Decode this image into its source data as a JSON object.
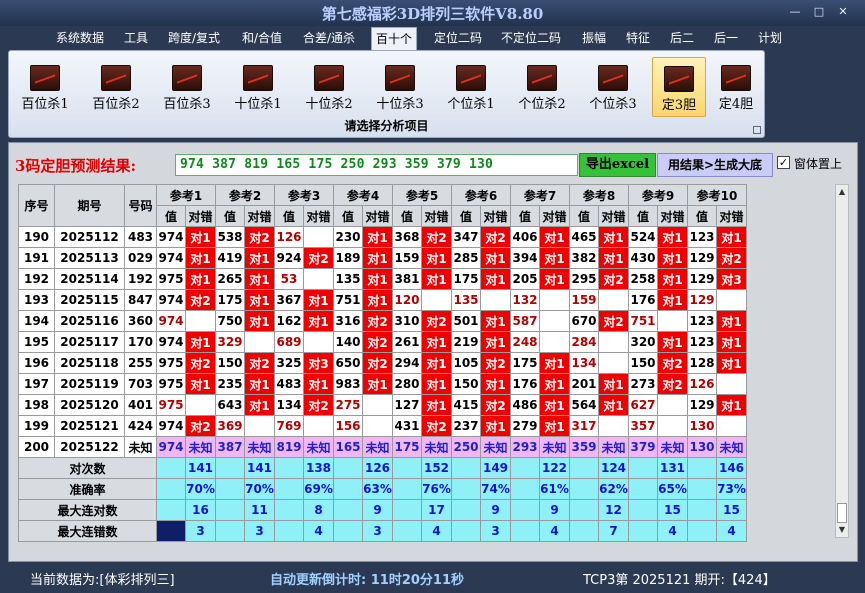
{
  "app": {
    "title": "第七感福彩3D排列三软件V8.80",
    "min": "—",
    "max": "□",
    "close": "✕"
  },
  "menu": [
    "系统数据",
    "工具",
    "跨度/复式",
    "和/合值",
    "合差/通杀",
    "百十个",
    "定位二码",
    "不定位二码",
    "振幅",
    "特征",
    "后二",
    "后一",
    "计划"
  ],
  "ribbon": {
    "buttons": [
      "百位杀1",
      "百位杀2",
      "百位杀3",
      "十位杀1",
      "十位杀2",
      "十位杀3",
      "个位杀1",
      "个位杀2",
      "个位杀3",
      "定3胆",
      "定4胆"
    ],
    "caption": "请选择分析项目"
  },
  "prediction": {
    "label": "3码定胆预测结果:",
    "value": "974 387 819 165 175 250 293 359 379 130",
    "export_label": "导出excel",
    "generate_label": "用结果>生成大底",
    "ontop_label": "窗体置上",
    "ontop_checked": "✓"
  },
  "table": {
    "h_seq": "序号",
    "h_period": "期号",
    "h_code": "号码",
    "groups": [
      "参考1",
      "参考2",
      "参考3",
      "参考4",
      "参考5",
      "参考6",
      "参考7",
      "参考8",
      "参考9",
      "参考10"
    ],
    "sub_val": "值",
    "sub_ok": "对错",
    "rows": [
      {
        "seq": "190",
        "period": "2025112",
        "code": "483",
        "refs": [
          [
            "974",
            "对1"
          ],
          [
            "538",
            "对2"
          ],
          [
            "126",
            ""
          ],
          [
            "230",
            "对1"
          ],
          [
            "368",
            "对2"
          ],
          [
            "347",
            "对2"
          ],
          [
            "406",
            "对1"
          ],
          [
            "465",
            "对1"
          ],
          [
            "524",
            "对1"
          ],
          [
            "123",
            "对1"
          ]
        ]
      },
      {
        "seq": "191",
        "period": "2025113",
        "code": "029",
        "refs": [
          [
            "974",
            "对1"
          ],
          [
            "419",
            "对1"
          ],
          [
            "924",
            "对2"
          ],
          [
            "189",
            "对1"
          ],
          [
            "159",
            "对1"
          ],
          [
            "285",
            "对1"
          ],
          [
            "394",
            "对1"
          ],
          [
            "382",
            "对1"
          ],
          [
            "430",
            "对1"
          ],
          [
            "129",
            "对2"
          ]
        ]
      },
      {
        "seq": "192",
        "period": "2025114",
        "code": "192",
        "refs": [
          [
            "975",
            "对1"
          ],
          [
            "265",
            "对1"
          ],
          [
            "53",
            ""
          ],
          [
            "135",
            "对1"
          ],
          [
            "381",
            "对1"
          ],
          [
            "175",
            "对1"
          ],
          [
            "205",
            "对1"
          ],
          [
            "295",
            "对2"
          ],
          [
            "258",
            "对1"
          ],
          [
            "129",
            "对3"
          ]
        ]
      },
      {
        "seq": "193",
        "period": "2025115",
        "code": "847",
        "refs": [
          [
            "974",
            "对2"
          ],
          [
            "175",
            "对1"
          ],
          [
            "367",
            "对1"
          ],
          [
            "751",
            "对1"
          ],
          [
            "120",
            ""
          ],
          [
            "135",
            ""
          ],
          [
            "132",
            ""
          ],
          [
            "159",
            ""
          ],
          [
            "176",
            "对1"
          ],
          [
            "129",
            ""
          ]
        ]
      },
      {
        "seq": "194",
        "period": "2025116",
        "code": "360",
        "refs": [
          [
            "974",
            ""
          ],
          [
            "750",
            "对1"
          ],
          [
            "162",
            "对1"
          ],
          [
            "316",
            "对2"
          ],
          [
            "310",
            "对2"
          ],
          [
            "501",
            "对1"
          ],
          [
            "587",
            ""
          ],
          [
            "670",
            "对2"
          ],
          [
            "751",
            ""
          ],
          [
            "123",
            "对1"
          ]
        ]
      },
      {
        "seq": "195",
        "period": "2025117",
        "code": "170",
        "refs": [
          [
            "974",
            "对1"
          ],
          [
            "329",
            ""
          ],
          [
            "689",
            ""
          ],
          [
            "140",
            "对2"
          ],
          [
            "261",
            "对1"
          ],
          [
            "219",
            "对1"
          ],
          [
            "248",
            ""
          ],
          [
            "284",
            ""
          ],
          [
            "320",
            "对1"
          ],
          [
            "123",
            "对1"
          ]
        ]
      },
      {
        "seq": "196",
        "period": "2025118",
        "code": "255",
        "refs": [
          [
            "975",
            "对2"
          ],
          [
            "150",
            "对2"
          ],
          [
            "325",
            "对3"
          ],
          [
            "650",
            "对2"
          ],
          [
            "294",
            "对1"
          ],
          [
            "105",
            "对2"
          ],
          [
            "175",
            "对1"
          ],
          [
            "134",
            ""
          ],
          [
            "150",
            "对2"
          ],
          [
            "128",
            "对1"
          ]
        ]
      },
      {
        "seq": "197",
        "period": "2025119",
        "code": "703",
        "refs": [
          [
            "975",
            "对1"
          ],
          [
            "235",
            "对1"
          ],
          [
            "483",
            "对1"
          ],
          [
            "983",
            "对1"
          ],
          [
            "280",
            "对1"
          ],
          [
            "150",
            "对1"
          ],
          [
            "176",
            "对1"
          ],
          [
            "201",
            "对1"
          ],
          [
            "273",
            "对2"
          ],
          [
            "126",
            ""
          ]
        ]
      },
      {
        "seq": "198",
        "period": "2025120",
        "code": "401",
        "refs": [
          [
            "975",
            ""
          ],
          [
            "643",
            "对1"
          ],
          [
            "134",
            "对2"
          ],
          [
            "275",
            ""
          ],
          [
            "127",
            "对1"
          ],
          [
            "415",
            "对2"
          ],
          [
            "486",
            "对1"
          ],
          [
            "564",
            "对1"
          ],
          [
            "627",
            ""
          ],
          [
            "129",
            "对1"
          ]
        ]
      },
      {
        "seq": "199",
        "period": "2025121",
        "code": "424",
        "refs": [
          [
            "974",
            "对2"
          ],
          [
            "369",
            ""
          ],
          [
            "769",
            ""
          ],
          [
            "156",
            ""
          ],
          [
            "431",
            "对2"
          ],
          [
            "237",
            "对1"
          ],
          [
            "279",
            "对1"
          ],
          [
            "317",
            ""
          ],
          [
            "357",
            ""
          ],
          [
            "130",
            ""
          ]
        ]
      },
      {
        "seq": "200",
        "period": "2025122",
        "code": "未知",
        "refs": [
          [
            "974",
            "未知"
          ],
          [
            "387",
            "未知"
          ],
          [
            "819",
            "未知"
          ],
          [
            "165",
            "未知"
          ],
          [
            "175",
            "未知"
          ],
          [
            "250",
            "未知"
          ],
          [
            "293",
            "未知"
          ],
          [
            "359",
            "未知"
          ],
          [
            "379",
            "未知"
          ],
          [
            "130",
            "未知"
          ]
        ]
      }
    ],
    "stats": [
      {
        "label": "对次数",
        "values": [
          "141",
          "141",
          "138",
          "126",
          "152",
          "149",
          "122",
          "124",
          "131",
          "146"
        ]
      },
      {
        "label": "准确率",
        "values": [
          "70%",
          "70%",
          "69%",
          "63%",
          "76%",
          "74%",
          "61%",
          "62%",
          "65%",
          "73%"
        ]
      },
      {
        "label": "最大连对数",
        "values": [
          "16",
          "11",
          "8",
          "9",
          "17",
          "9",
          "9",
          "12",
          "15",
          "15"
        ]
      },
      {
        "label": "最大连错数",
        "values": [
          "3",
          "3",
          "4",
          "3",
          "4",
          "3",
          "4",
          "7",
          "4",
          "4"
        ]
      }
    ]
  },
  "status": {
    "current": "当前数据为:[体彩排列三]",
    "countdown": "自动更新倒计时: 11时20分11秒",
    "info": "TCP3第 2025121 期开:【424】"
  }
}
